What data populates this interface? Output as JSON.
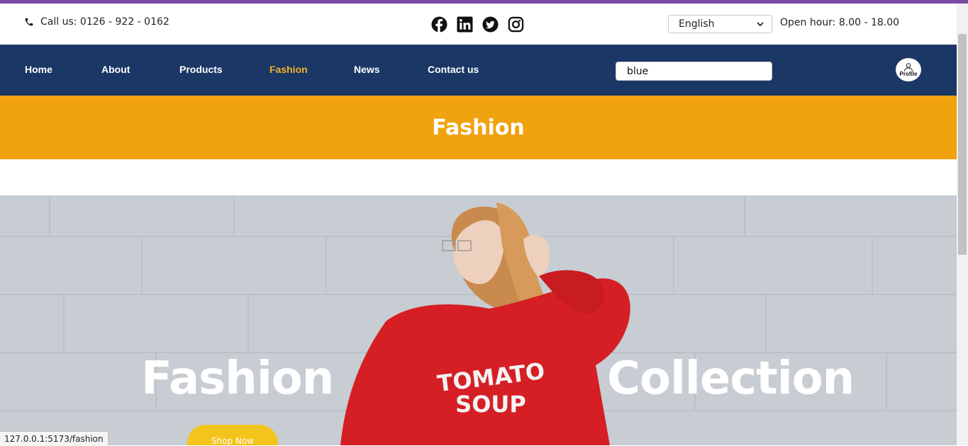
{
  "topbar": {
    "phone_icon": "phone-icon",
    "call_text": "Call us: 0126 - 922 - 0162",
    "socials": [
      "facebook-icon",
      "linkedin-icon",
      "twitter-icon",
      "instagram-icon"
    ],
    "language": "English",
    "open_hours": "Open hour: 8.00 - 18.00"
  },
  "nav": {
    "items": [
      {
        "label": "Home"
      },
      {
        "label": "About"
      },
      {
        "label": "Products"
      },
      {
        "label": "Fashion",
        "active": true
      },
      {
        "label": "News"
      },
      {
        "label": "Contact us"
      }
    ],
    "search_value": "blue",
    "profile_label": "Profile"
  },
  "banner": {
    "title": "Fashion"
  },
  "hero": {
    "word_left": "Fashion",
    "word_right": "Collection",
    "shirt_text_1": "TOMATO",
    "shirt_text_2": "SOUP",
    "cta_label": "Shop Now"
  },
  "status_bar": {
    "url": "127.0.0.1:5173/fashion"
  },
  "colors": {
    "navbar": "#1b3766",
    "accent_active": "#f2b02a",
    "banner": "#f1a20f",
    "cta": "#f3c41c",
    "top_accent": "#7b4aa5"
  }
}
